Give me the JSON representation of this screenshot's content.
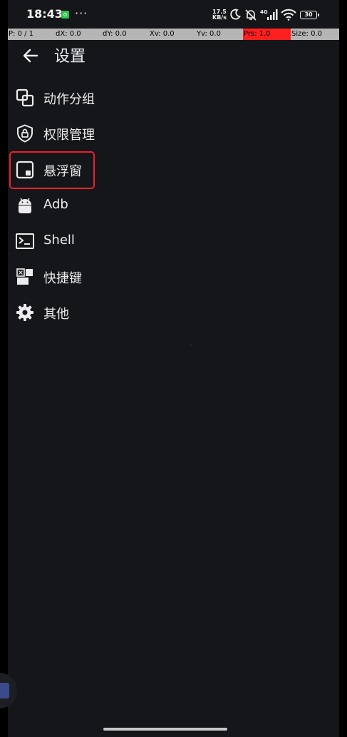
{
  "status_bar": {
    "time": "18:43",
    "more": "···",
    "net_speed_value": "17.5",
    "net_speed_unit": "KB/s",
    "signal_label": "4G",
    "battery": "30",
    "icons": [
      "app-notification-icon",
      "moon-icon",
      "muted-bell-icon",
      "cellular-signal-icon",
      "wifi-icon",
      "battery-icon"
    ]
  },
  "pointer_bar": {
    "cells": [
      "P: 0 / 1",
      "dX: 0.0",
      "dY: 0.0",
      "Xv: 0.0",
      "Yv: 0.0",
      "Prs: 1.0",
      "Size: 0.0"
    ],
    "highlight_color": "#ff1f1f"
  },
  "app_bar": {
    "title": "设置",
    "back_icon": "arrow-left-icon"
  },
  "menu": [
    {
      "label": "动作分组",
      "icon": "layers-icon"
    },
    {
      "label": "权限管理",
      "icon": "shield-lock-icon"
    },
    {
      "label": "悬浮窗",
      "icon": "picture-in-picture-icon",
      "selected": true
    },
    {
      "label": "Adb",
      "icon": "android-icon"
    },
    {
      "label": "Shell",
      "icon": "terminal-icon"
    },
    {
      "label": "快捷键",
      "icon": "shortcut-icon"
    },
    {
      "label": "其他",
      "icon": "gear-icon"
    }
  ],
  "colors": {
    "background": "#15161a",
    "text": "#ececec",
    "highlight_border": "#e8212e",
    "pointer_bar": "#b5b5b5"
  }
}
